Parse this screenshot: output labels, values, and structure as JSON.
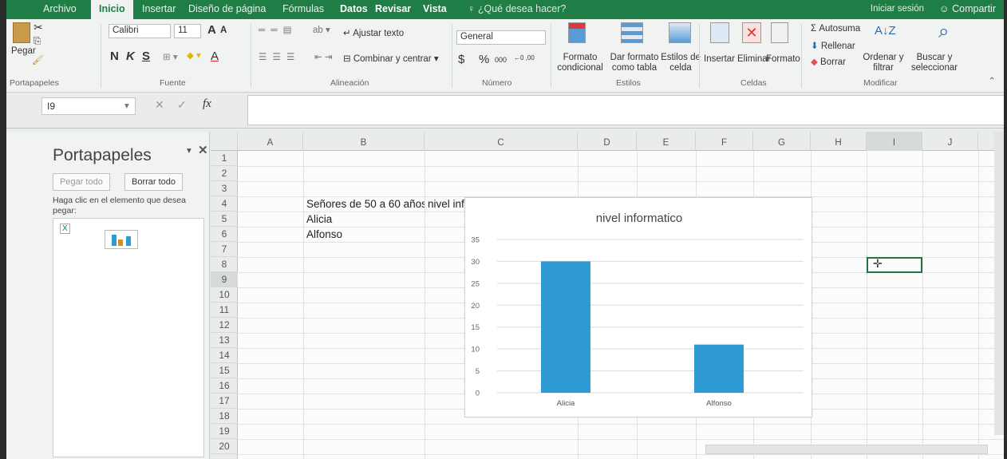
{
  "ribbon": {
    "tabs": [
      "Archivo",
      "Inicio",
      "Insertar",
      "Diseño de página",
      "Fórmulas",
      "Datos",
      "Revisar",
      "Vista"
    ],
    "active_tab": "Inicio",
    "tell_me": "¿Qué desea hacer?",
    "sign_in": "Iniciar sesión",
    "share": "Compartir",
    "clipboard": {
      "paste": "Pegar",
      "label": "Portapapeles"
    },
    "font": {
      "name": "Calibri",
      "size": "11",
      "bold": "N",
      "italic": "K",
      "underline": "S",
      "grow": "A",
      "shrink": "A",
      "color_a": "A",
      "label": "Fuente"
    },
    "alignment": {
      "wrap": "Ajustar texto",
      "merge": "Combinar y centrar",
      "label": "Alineación"
    },
    "number": {
      "format": "General",
      "currency": "$",
      "percent": "%",
      "thousands": "000",
      "dec_inc": "←0 ,00",
      "dec_dec": ",00 →,0",
      "label": "Número"
    },
    "styles": {
      "conditional": "Formato condicional",
      "as_table": "Dar formato como tabla",
      "cell_styles": "Estilos de celda",
      "label": "Estilos"
    },
    "cells": {
      "insert": "Insertar",
      "delete": "Eliminar",
      "format": "Formato",
      "label": "Celdas"
    },
    "editing": {
      "autosum": "Autosuma",
      "fill": "Rellenar",
      "clear": "Borrar",
      "sort": "Ordenar y filtrar",
      "find": "Buscar y seleccionar",
      "label": "Modificar"
    }
  },
  "formula_bar": {
    "name_box": "I9",
    "fx": "fx"
  },
  "clipboard_pane": {
    "title": "Portapapeles",
    "paste_all": "Pegar todo",
    "clear_all": "Borrar todo",
    "hint": "Haga clic en el elemento que desea pegar:"
  },
  "sheet": {
    "columns": [
      "A",
      "B",
      "C",
      "D",
      "E",
      "F",
      "G",
      "H",
      "I",
      "J"
    ],
    "rows": [
      "1",
      "2",
      "3",
      "4",
      "5",
      "6",
      "7",
      "8",
      "9",
      "10",
      "11",
      "12",
      "13",
      "14",
      "15",
      "16",
      "17",
      "18",
      "19",
      "20"
    ],
    "cells": {
      "B4": "Señores de 50 a 60 años",
      "C4": "nivel informatico",
      "B5": "Alicia",
      "B6": "Alfonso"
    },
    "selected": "I9"
  },
  "colors": {
    "accent": "#217346",
    "bar": "#2e9bd4"
  },
  "chart_data": {
    "type": "bar",
    "title": "nivel informatico",
    "categories": [
      "Alicia",
      "Alfonso"
    ],
    "values": [
      30,
      11
    ],
    "ylim": [
      0,
      35
    ],
    "yticks": [
      0,
      5,
      10,
      15,
      20,
      25,
      30,
      35
    ],
    "grid": true
  }
}
